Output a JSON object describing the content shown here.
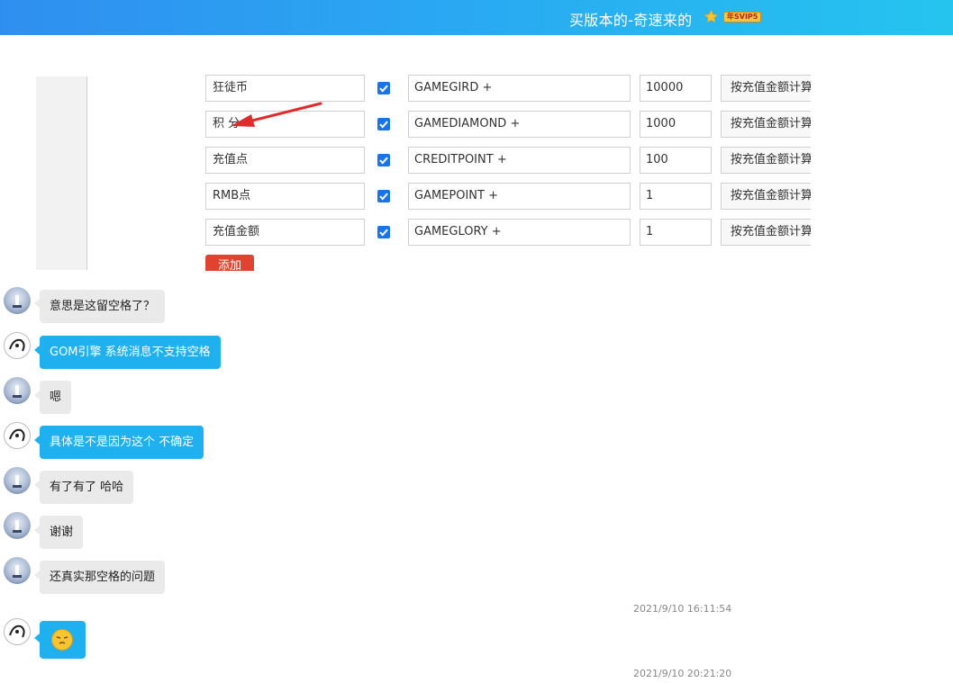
{
  "header": {
    "title": "买版本的-奇速来的",
    "badge": "年SVIP5"
  },
  "form": {
    "rows": [
      {
        "name": "狂徒币",
        "checked": true,
        "code": "GAMEGIRD +",
        "value": "10000",
        "mode": "按充值金额计算"
      },
      {
        "name": "积  分",
        "checked": true,
        "code": "GAMEDIAMOND +",
        "value": "1000",
        "mode": "按充值金额计算"
      },
      {
        "name": "充值点",
        "checked": true,
        "code": "CREDITPOINT +",
        "value": "100",
        "mode": "按充值金额计算"
      },
      {
        "name": "RMB点",
        "checked": true,
        "code": "GAMEPOINT +",
        "value": "1",
        "mode": "按充值金额计算"
      },
      {
        "name": "充值金额",
        "checked": true,
        "code": "GAMEGLORY +",
        "value": "1",
        "mode": "按充值金额计算"
      }
    ],
    "add_label": "添加"
  },
  "chat": {
    "messages": [
      {
        "sender": "other",
        "text": "意思是这留空格了？"
      },
      {
        "sender": "me",
        "text": "GOM引擎 系统消息不支持空格"
      },
      {
        "sender": "other",
        "text": "嗯"
      },
      {
        "sender": "me",
        "text": "具体是不是因为这个 不确定"
      },
      {
        "sender": "other",
        "text": "有了有了 哈哈"
      },
      {
        "sender": "other",
        "text": "谢谢"
      },
      {
        "sender": "other",
        "text": "还真实那空格的问题"
      }
    ],
    "timestamps": [
      "2021/9/10 16:11:54",
      "2021/9/10 20:21:20"
    ],
    "emoji_message": {
      "sender": "me",
      "icon": "emoji-face-icon"
    }
  },
  "colors": {
    "header_start": "#2f8ff0",
    "header_end": "#25c4ef",
    "bubble_me": "#1fb0f0",
    "bubble_other": "#eaeaea",
    "add_button": "#e0432f",
    "annotation_arrow": "#e02b2b"
  }
}
